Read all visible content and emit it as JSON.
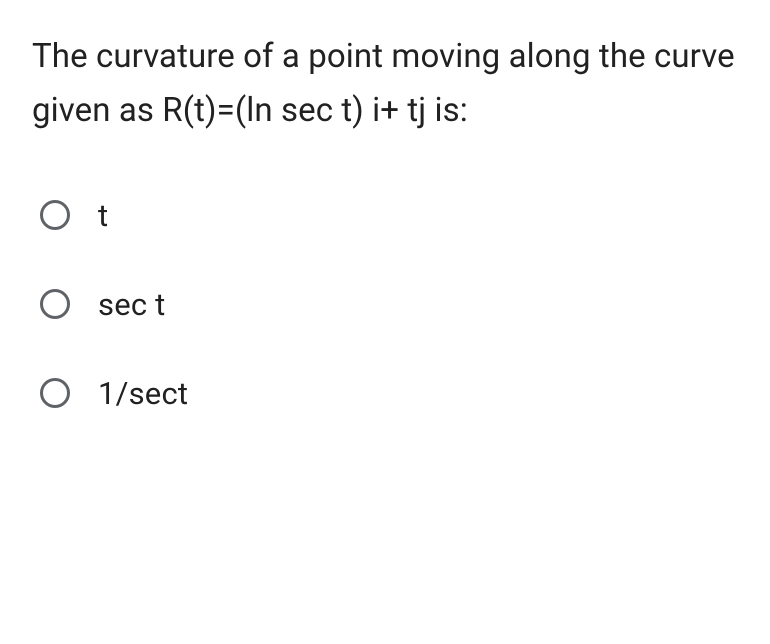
{
  "question": "The curvature of a point moving along the curve given as R(t)=(ln sec t) i+ tj is:",
  "options": [
    {
      "label": "t"
    },
    {
      "label": "sec t"
    },
    {
      "label": "1/sect"
    }
  ]
}
